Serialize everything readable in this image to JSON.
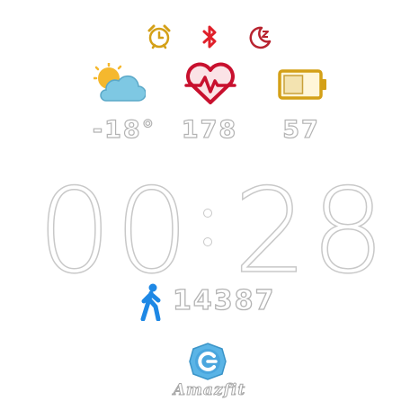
{
  "status_icons": [
    "alarm-icon",
    "bluetooth-icon",
    "do-not-disturb-moon-icon"
  ],
  "weather": {
    "icon": "partly-cloudy-icon",
    "temperature": "-18°"
  },
  "heart_rate": {
    "icon": "heart-pulse-icon",
    "value": "178"
  },
  "battery": {
    "icon": "battery-icon",
    "value": "57",
    "level_percent": 57
  },
  "time": {
    "h1": "0",
    "h2": "0",
    "m1": "2",
    "m2": "8"
  },
  "steps": {
    "icon": "walking-person-icon",
    "value": "14387"
  },
  "brand": {
    "logo": "amazfit-logo-icon",
    "name": "Amazfit"
  },
  "colors": {
    "alarm": "#d4a017",
    "bluetooth": "#e0202a",
    "dnd": "#b8232f",
    "heart": "#c8102e",
    "battery": "#d4a017",
    "cloud": "#7ec8e3",
    "sun": "#f5b82e",
    "walker": "#1e88e5",
    "logo": "#5ab4e6"
  }
}
